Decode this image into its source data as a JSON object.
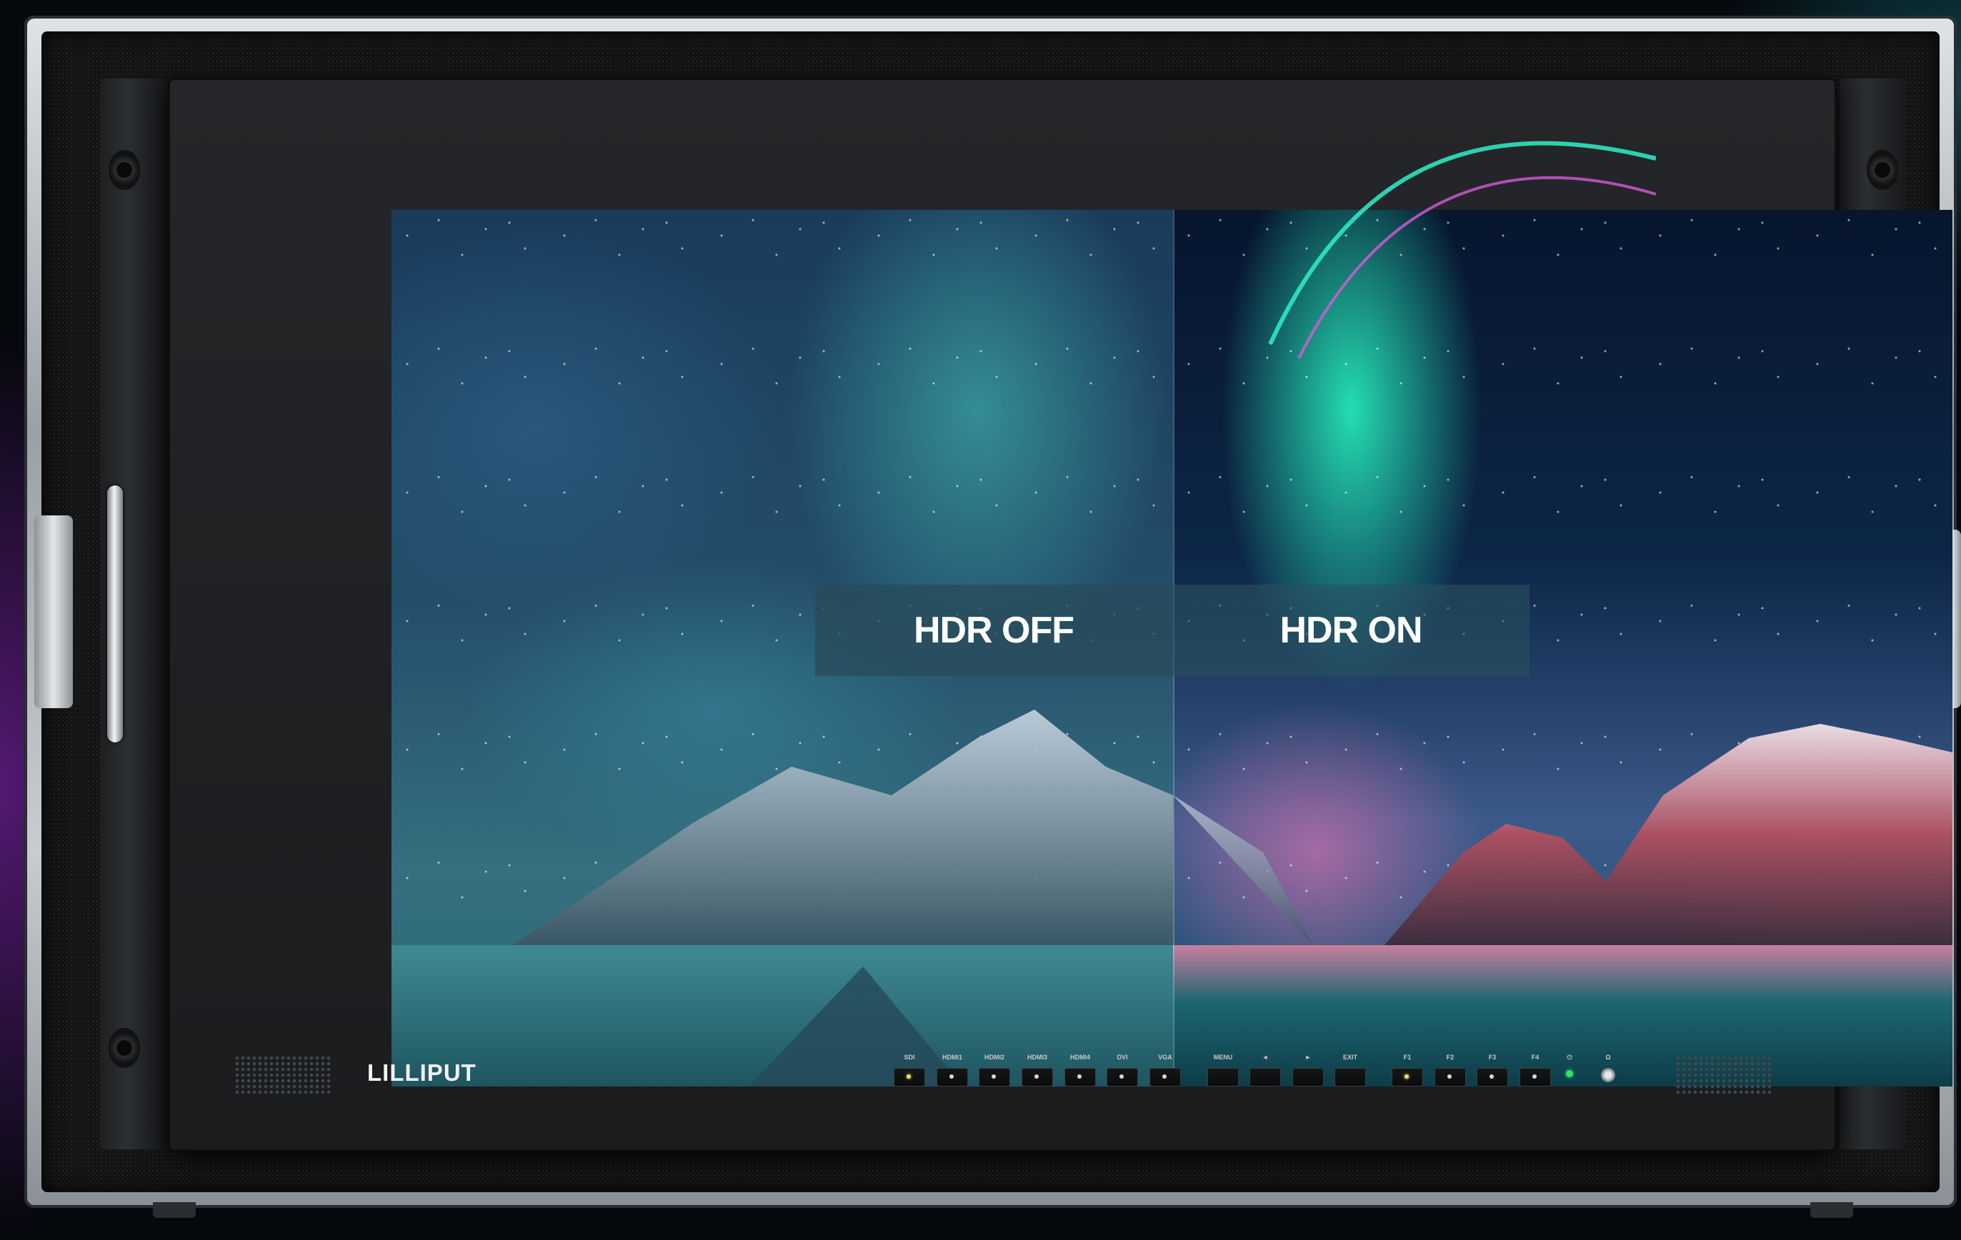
{
  "screen": {
    "left_label": "HDR OFF",
    "right_label": "HDR ON"
  },
  "bezel": {
    "brand": "LILLIPUT",
    "inputs": [
      {
        "label": "SDI",
        "led": "yellow"
      },
      {
        "label": "HDMI1",
        "led": "white"
      },
      {
        "label": "HDMI2",
        "led": "white"
      },
      {
        "label": "HDMI3",
        "led": "white"
      },
      {
        "label": "HDMI4",
        "led": "white"
      },
      {
        "label": "DVI",
        "led": "white"
      },
      {
        "label": "VGA",
        "led": "white"
      }
    ],
    "nav": [
      "MENU",
      "◄",
      "►",
      "EXIT"
    ],
    "functions": [
      {
        "label": "F1",
        "led": "yellow"
      },
      {
        "label": "F2",
        "led": "white"
      },
      {
        "label": "F3",
        "led": "white"
      },
      {
        "label": "F4",
        "led": "white"
      }
    ],
    "power_symbol": "⏻",
    "headphone_symbol": "Ω"
  },
  "colors": {
    "led_yellow": "#e9e36b",
    "led_power": "#35e06a",
    "aurora": "#2ef0c8"
  }
}
